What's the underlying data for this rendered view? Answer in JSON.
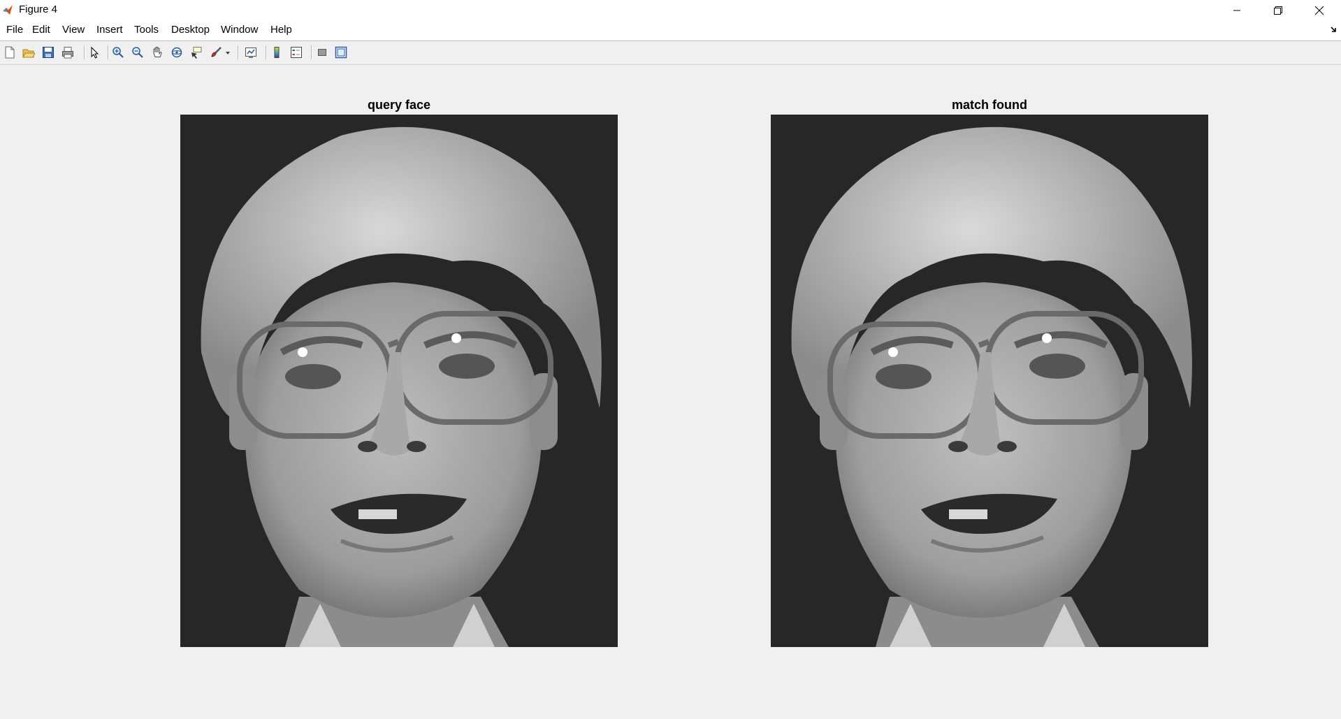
{
  "window": {
    "title": "Figure 4",
    "icon": "matlab-icon",
    "controls": [
      "minimize-icon",
      "restore-icon",
      "close-icon"
    ]
  },
  "menu": [
    "File",
    "Edit",
    "View",
    "Insert",
    "Tools",
    "Desktop",
    "Window",
    "Help"
  ],
  "toolbar": [
    "new-figure-icon",
    "open-file-icon",
    "save-icon",
    "print-icon",
    "edit-plot-arrow-icon",
    "zoom-in-icon",
    "zoom-out-icon",
    "pan-hand-icon",
    "rotate-3d-icon",
    "data-cursor-icon",
    "brush-icon",
    "link-plot-icon",
    "insert-colorbar-icon",
    "insert-legend-icon",
    "hide-plot-tools-icon",
    "show-plot-tools-icon"
  ],
  "axes": [
    {
      "title": "query face",
      "image": "grayscale-face-photo"
    },
    {
      "title": "match found",
      "image": "grayscale-face-photo"
    }
  ]
}
